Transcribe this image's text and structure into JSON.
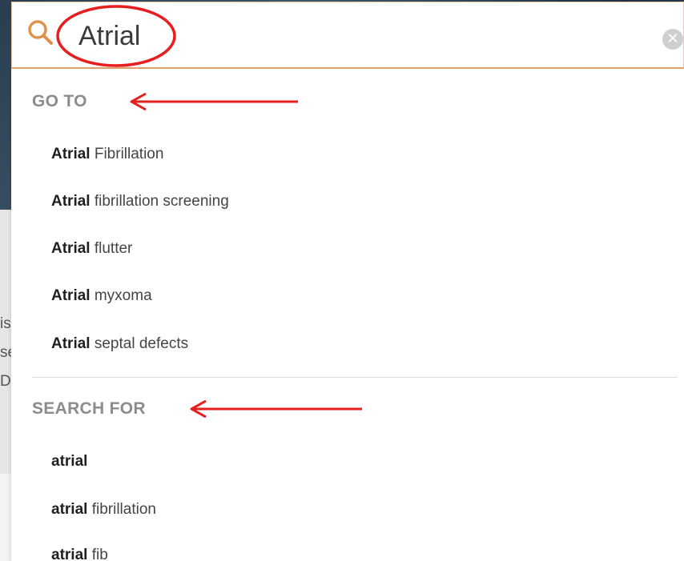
{
  "background": {
    "peek_lines": [
      "is",
      "se",
      "Di"
    ]
  },
  "search": {
    "value": "Atrial",
    "clear_icon": "clear-circle-icon",
    "search_icon": "magnifier-icon"
  },
  "dropdown": {
    "goto_heading": "GO TO",
    "goto_items": [
      {
        "match": "Atrial",
        "rest": " Fibrillation"
      },
      {
        "match": "Atrial",
        "rest": " fibrillation screening"
      },
      {
        "match": "Atrial",
        "rest": " flutter"
      },
      {
        "match": "Atrial",
        "rest": " myxoma"
      },
      {
        "match": "Atrial",
        "rest": " septal defects"
      }
    ],
    "searchfor_heading": "SEARCH FOR",
    "searchfor_items": [
      {
        "match": "atrial",
        "rest": ""
      },
      {
        "match": "atrial",
        "rest": " fibrillation"
      },
      {
        "match": "atrial",
        "rest": " fib"
      }
    ]
  },
  "colors": {
    "accent_border": "#e8a36a",
    "search_icon": "#e0924a",
    "annotation_red": "#e61e1e",
    "heading_gray": "#8c8c8c"
  }
}
